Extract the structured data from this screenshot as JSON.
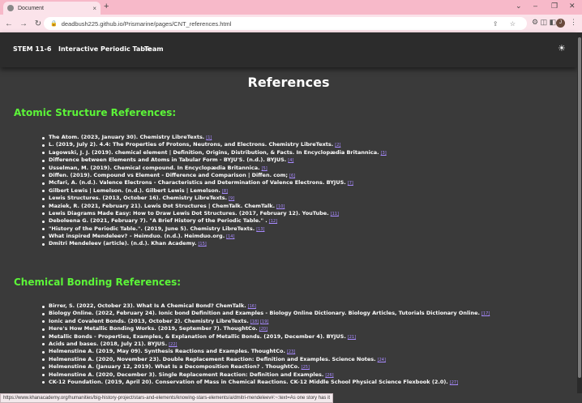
{
  "browser": {
    "tab_title": "Document",
    "tab_close": "×",
    "new_tab": "+",
    "url": "deadbush225.github.io/Prismarine/pages/CNT_references.html",
    "avatar_letter": "J",
    "win_min": "⌄",
    "win_minimize": "–",
    "win_restore": "❐",
    "win_close": "✕",
    "back": "←",
    "forward": "→",
    "reload": "↻",
    "lock": "🔒",
    "omni_icons": "⇪ ☆",
    "ext_icons": "⚙ ◫ ◧",
    "menu": "⋮"
  },
  "nav": {
    "items": [
      "STEM 11-6",
      "Interactive Periodic Table",
      "Team"
    ],
    "theme_icon": "☀"
  },
  "page": {
    "title": "References"
  },
  "sections": [
    {
      "heading": "Atomic Structure References:",
      "refs": [
        {
          "text": "The Atom. (2023, January 30). Chemistry LibreTexts.",
          "link": "[1]"
        },
        {
          "text": "L. (2019, July 2). 4.4: The Properties of Protons, Neutrons, and Electrons. Chemistry LibreTexts.",
          "link": "[2]"
        },
        {
          "text": "Lagowski, J. J. (2019). chemical element | Definition, Origins, Distribution, & Facts. In Encyclopædia Britannica.",
          "link": "[3]"
        },
        {
          "text": "Difference between Elements and Atoms in Tabular Form - BYJU'S. (n.d.). BYJUS.",
          "link": "[4]"
        },
        {
          "text": "Usselman, M. (2019). Chemical compound. In Encyclopædia Britannica.",
          "link": "[5]"
        },
        {
          "text": "Diffen. (2019). Compound vs Element - Difference and Comparison | Diffen. com;",
          "link": "[6]"
        },
        {
          "text": "Mcfari, A. (n.d.). Valence Electrons - Characteristics and Determination of Valence Electrons. BYJUS.",
          "link": "[7]"
        },
        {
          "text": "Gilbert Lewis | Lemelson. (n.d.). Gilbert Lewis | Lemelson.",
          "link": "[8]"
        },
        {
          "text": "Lewis Structures. (2013, October 16). Chemistry LibreTexts.",
          "link": "[9]"
        },
        {
          "text": "Maziek, R. (2021, February 21). Lewis Dot Structures | ChemTalk. ChemTalk.",
          "link": "[10]"
        },
        {
          "text": "Lewis Diagrams Made Easy: How to Draw Lewis Dot Structures. (2017, February 12). YouTube.",
          "link": "[11]"
        },
        {
          "text": "Deboleena G. (2021, February 7). \"A Brief History of the Periodic Table.\" .",
          "link": "[12]"
        },
        {
          "text": "\"History of the Periodic Table.\". (2019, June 5). Chemistry LibreTexts.",
          "link": "[13]"
        },
        {
          "text": "What inspired Mendeleev? – Heimduo. (n.d.). Heimduo.org.",
          "link": "[14]"
        },
        {
          "text": "Dmitri Mendeleev (article). (n.d.). Khan Academy.",
          "link": "[15]"
        }
      ]
    },
    {
      "heading": "Chemical Bonding References:",
      "refs": [
        {
          "text": "Birrer, S. (2022, October 23). What Is A Chemical Bond? ChemTalk.",
          "link": "[16]"
        },
        {
          "text": "Biology Online. (2022, February 24). Ionic bond Definition and Examples - Biology Online Dictionary. Biology Articles, Tutorials Dictionary Online.",
          "link": "[17]"
        },
        {
          "text": "Ionic and Covalent Bonds. (2013, October 2). Chemistry LibreTexts.",
          "link": "[18]",
          "link2": "[19]"
        },
        {
          "text": "Here's How Metallic Bonding Works. (2019, September 7). ThoughtCo.",
          "link": "[20]"
        },
        {
          "text": "Metallic Bonds - Properties, Examples, & Explanation of Metallic Bonds. (2019, December 4). BYJUS.",
          "link": "[21]"
        },
        {
          "text": "Acids and bases. (2018, July 21). BYJUS.",
          "link": "[22]"
        },
        {
          "text": "Helmenstine A. (2019, May 09). Synthesis Reactions and Examples. ThoughtCo.",
          "link": "[23]"
        },
        {
          "text": "Helmenstine A. (2020, November 23). Double Replacement Reaction: Definition and Examples. Science Notes.",
          "link": "[24]"
        },
        {
          "text": "Helmenstine A. (January 12, 2019). What Is a Decomposition Reaction? . ThoughtCo.",
          "link": "[25]"
        },
        {
          "text": "Helmenstine A. (2020, December 3). Single Replacement Reaction: Definition and Examples.",
          "link": "[26]"
        },
        {
          "text": "CK-12 Foundation. (2019, April 20). Conservation of Mass in Chemical Reactions. CK-12 Middle School Physical Science Flexbook (2.0).",
          "link": "[27]"
        }
      ]
    }
  ],
  "status_url": "https://www.khanacademy.org/humanities/big-history-project/stars-and-elements/knowing-stars-elements/a/dmitri-mendeleev#:~:text=As one story has it"
}
